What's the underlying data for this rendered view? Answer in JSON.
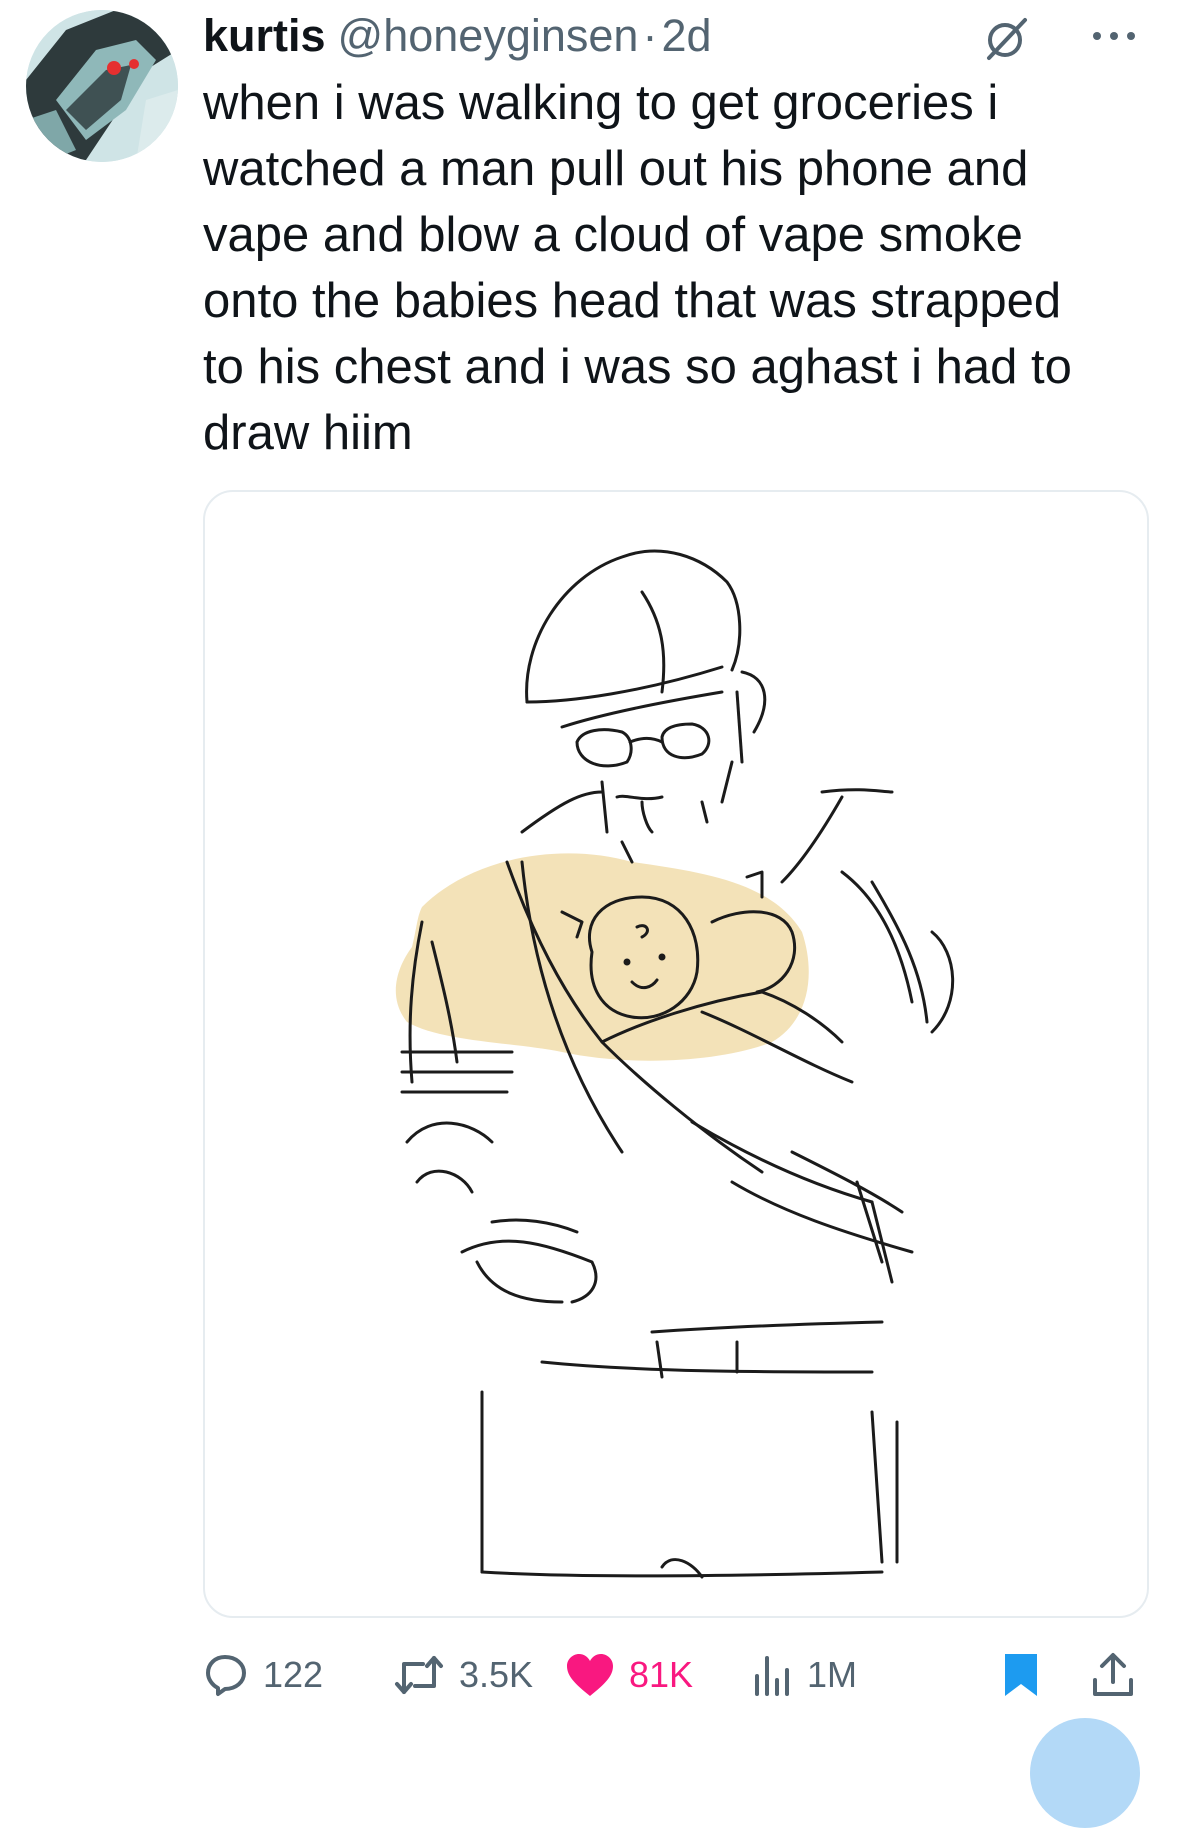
{
  "tweet": {
    "author_name": "kurtis",
    "handle": "@honeyginsen",
    "separator": "·",
    "time_ago": "2d",
    "text": "when i was walking to get groceries i\nwatched a man pull out his phone and\nvape and blow a cloud of vape smoke\nonto the babies head that was strapped\nto his chest and i was so aghast i had to\ndraw hiim"
  },
  "actions": {
    "replies": "122",
    "reposts": "3.5K",
    "likes": "81K",
    "views": "1M"
  },
  "icons": {
    "grok": "grok-icon",
    "more": "more-icon",
    "reply": "reply-icon",
    "repost": "repost-icon",
    "like": "heart-icon",
    "views": "views-icon",
    "bookmark": "bookmark-icon",
    "share": "share-icon"
  },
  "colors": {
    "text": "#0f1419",
    "secondary": "#536471",
    "like": "#f91880",
    "bookmark": "#1d9bf0",
    "sketch_highlight": "#f2dfb0"
  }
}
